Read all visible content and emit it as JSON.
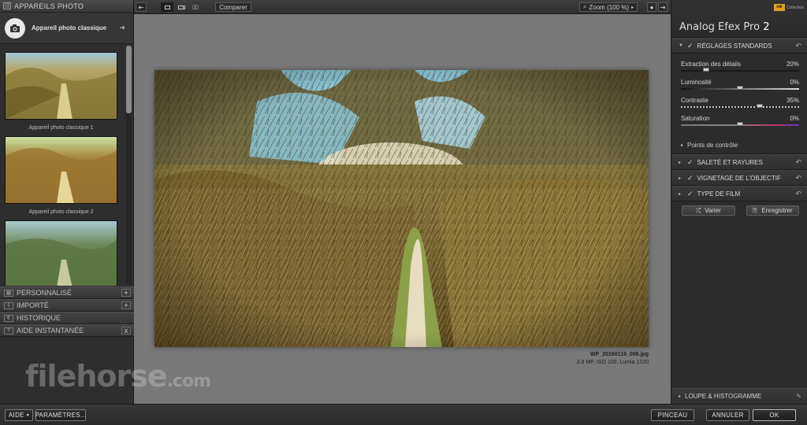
{
  "left_panel": {
    "header_title": "APPAREILS PHOTO",
    "preset_name": "Appareil photo classique",
    "thumbnails": [
      {
        "caption": "Appareil photo classique 1"
      },
      {
        "caption": "Appareil photo classique 2"
      },
      {
        "caption": ""
      }
    ],
    "accordion": [
      {
        "label": "PERSONNALISÉ",
        "icon": "custom-icon",
        "action": "+"
      },
      {
        "label": "IMPORTÉ",
        "icon": "import-icon",
        "action": "+"
      },
      {
        "label": "HISTORIQUE",
        "icon": "history-icon",
        "action": ""
      },
      {
        "label": "AIDE INSTANTANÉE",
        "icon": "help-icon",
        "action": "x"
      }
    ]
  },
  "toolbar": {
    "compare_label": "Comparer",
    "zoom_label": "Zoom (100 %)"
  },
  "image": {
    "filename": "WP_20160116_006.jpg",
    "details": "3.8 MP, ISO 100, Lumia 1320"
  },
  "watermark": {
    "text": "filehorse",
    "suffix": ".com"
  },
  "right_panel": {
    "product_name": "Analog Efex Pro",
    "product_version": "2",
    "brand_logo": "nik",
    "brand_sub": "Collection",
    "standard_section": "RÉGLAGES STANDARDS",
    "sliders": [
      {
        "label": "Extraction des détails",
        "value": "20%",
        "position": 0.2,
        "track": "plain"
      },
      {
        "label": "Luminosité",
        "value": "0%",
        "position": 0.5,
        "track": "gradient-grey"
      },
      {
        "label": "Contraste",
        "value": "35%",
        "position": 0.675,
        "track": "dashed"
      },
      {
        "label": "Saturation",
        "value": "0%",
        "position": 0.5,
        "track": "gradient-color"
      }
    ],
    "control_points": "Points de contrôle",
    "sections": [
      {
        "label": "SALETÉ ET RAYURES"
      },
      {
        "label": "VIGNETAGE DE L'OBJECTIF"
      },
      {
        "label": "TYPE DE FILM"
      }
    ],
    "vary_label": "Varier",
    "save_label": "Enregistrer",
    "loupe_label": "LOUPE & HISTOGRAMME"
  },
  "bottom": {
    "help_label": "AIDE",
    "settings_label": "PARAMÈTRES...",
    "brush_label": "PINCEAU",
    "cancel_label": "ANNULER",
    "ok_label": "OK"
  }
}
